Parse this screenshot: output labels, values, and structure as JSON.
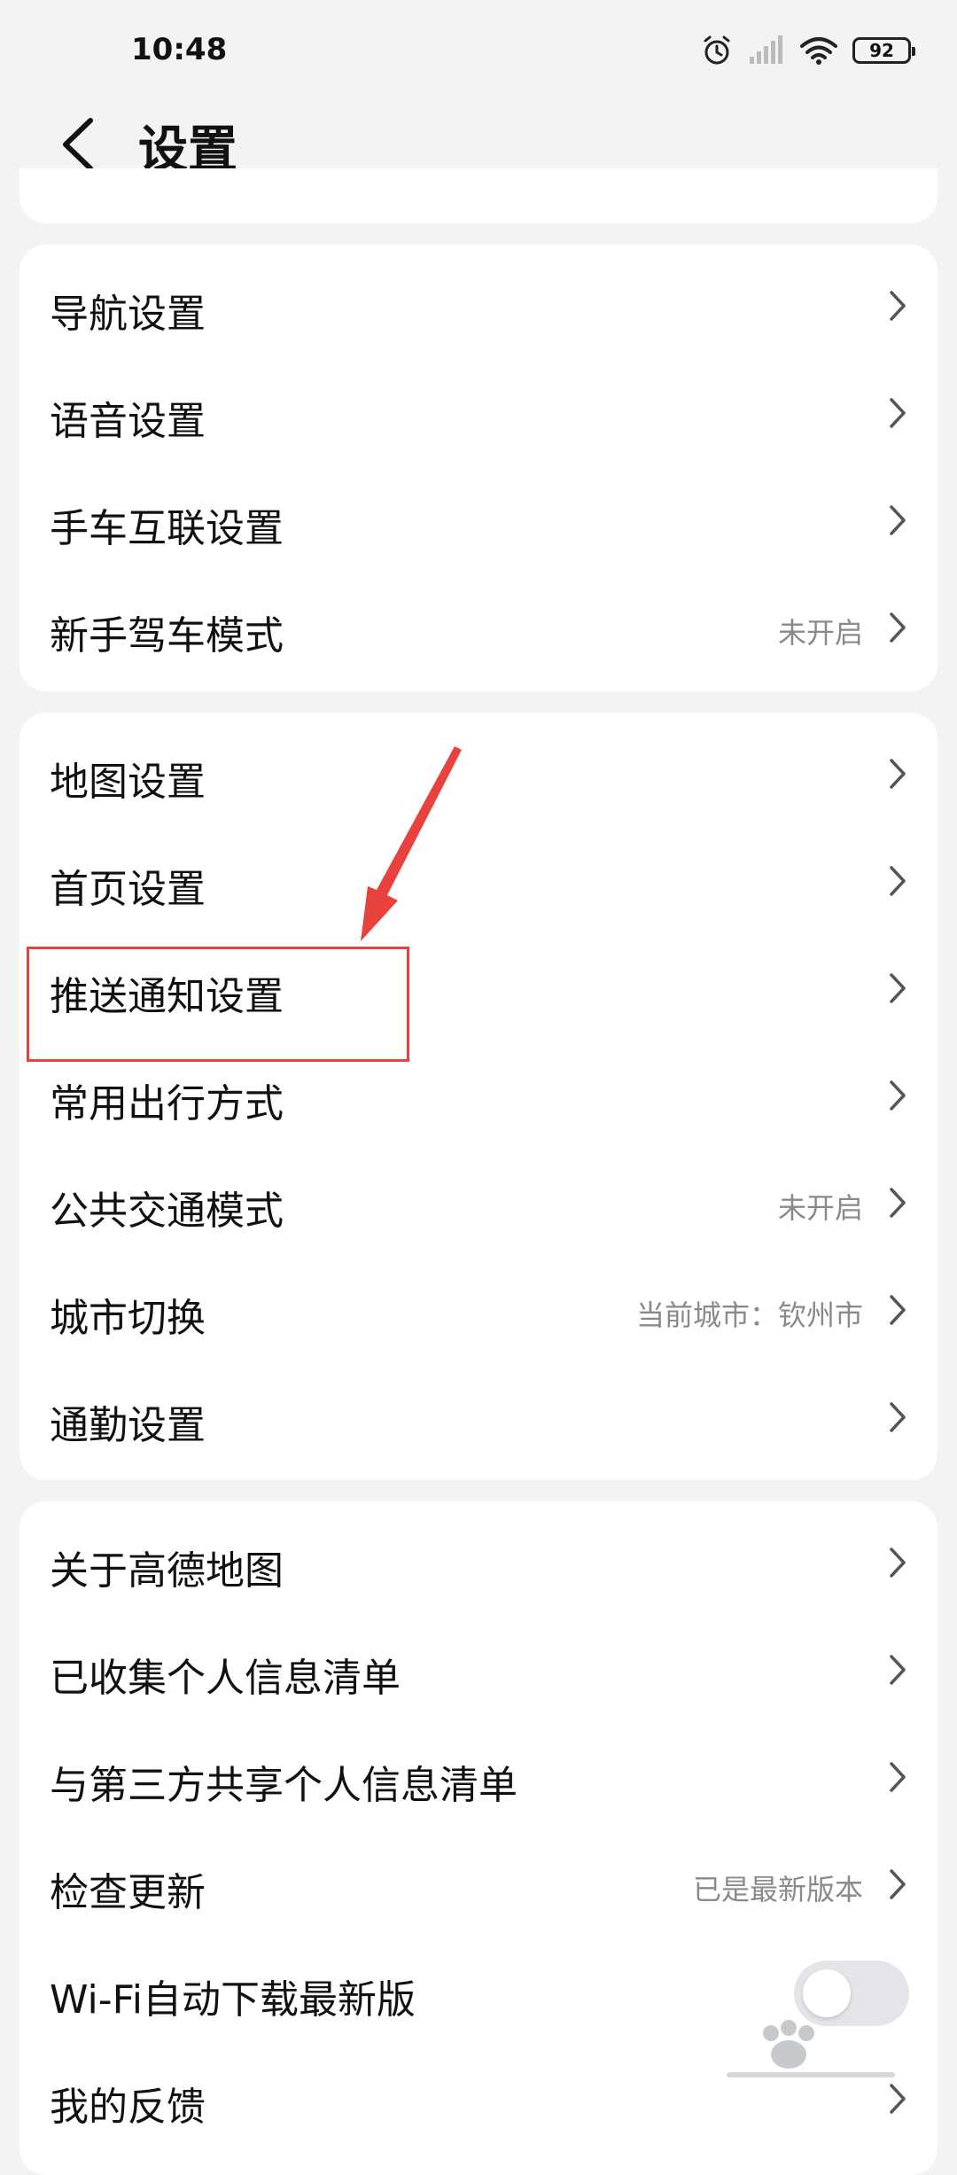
{
  "status_bar": {
    "time": "10:48",
    "battery": "92",
    "icons": [
      "alarm-icon",
      "signal-icon",
      "wifi-icon",
      "battery-icon"
    ]
  },
  "header": {
    "title": "设置",
    "back_icon": "chevron-left-icon"
  },
  "groups": [
    {
      "items": [
        {
          "label": "导航设置",
          "value": ""
        },
        {
          "label": "语音设置",
          "value": ""
        },
        {
          "label": "手车互联设置",
          "value": ""
        },
        {
          "label": "新手驾车模式",
          "value": "未开启"
        }
      ]
    },
    {
      "items": [
        {
          "label": "地图设置",
          "value": ""
        },
        {
          "label": "首页设置",
          "value": ""
        },
        {
          "label": "推送通知设置",
          "value": ""
        },
        {
          "label": "常用出行方式",
          "value": ""
        },
        {
          "label": "公共交通模式",
          "value": "未开启"
        },
        {
          "label": "城市切换",
          "value": "当前城市：钦州市"
        },
        {
          "label": "通勤设置",
          "value": ""
        }
      ]
    },
    {
      "items": [
        {
          "label": "关于高德地图",
          "value": ""
        },
        {
          "label": "已收集个人信息清单",
          "value": ""
        },
        {
          "label": "与第三方共享个人信息清单",
          "value": ""
        },
        {
          "label": "检查更新",
          "value": "已是最新版本"
        },
        {
          "label": "Wi-Fi自动下载最新版",
          "value": "",
          "toggle": false
        },
        {
          "label": "我的反馈",
          "value": ""
        }
      ]
    }
  ],
  "colors": {
    "background": "#f2f3f5",
    "card": "#ffffff",
    "annotation": "#e8413e",
    "secondary_text": "#8a8a8a"
  }
}
